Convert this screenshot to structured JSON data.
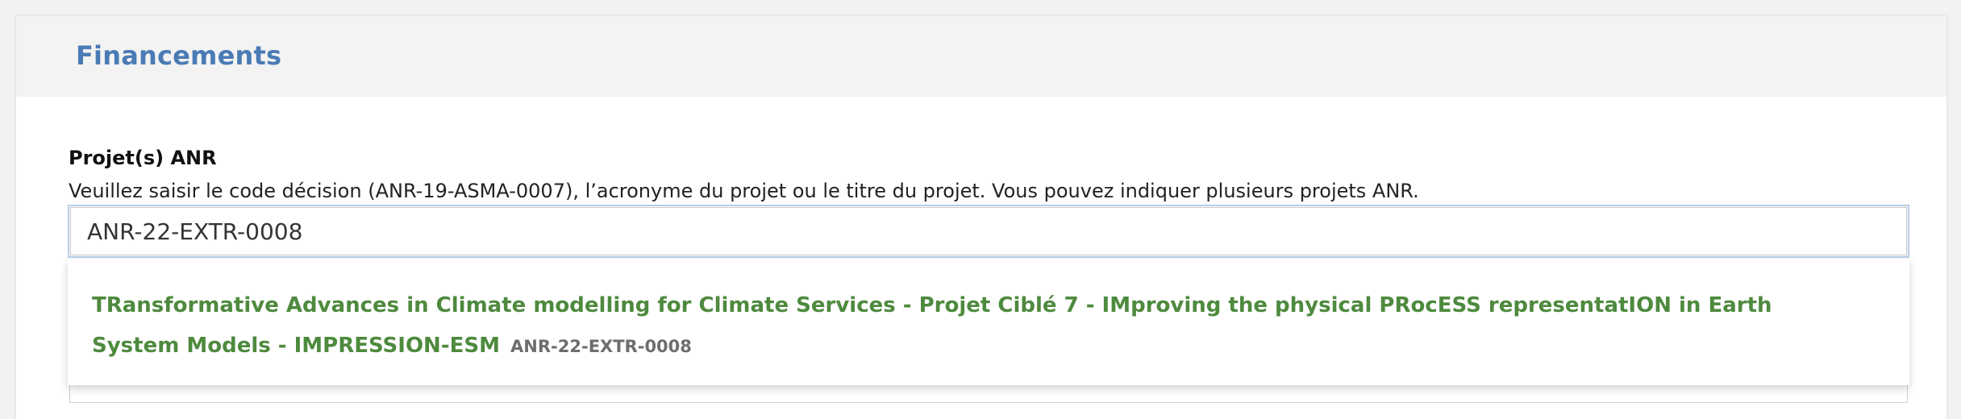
{
  "section": {
    "title": "Financements"
  },
  "field": {
    "label": "Projet(s) ANR",
    "help": "Veuillez saisir le code décision (ANR-19-ASMA-0007), l’acronyme du projet ou le titre du projet. Vous pouvez indiquer plusieurs projets ANR.",
    "value": "ANR-22-EXTR-0008"
  },
  "suggestions": [
    {
      "title": "TRansformative Advances in Climate modelling for Climate Services - Projet Ciblé 7 - IMproving the physical PRocESS representatION in Earth System Models - IMPRESSION-ESM",
      "code": "ANR-22-EXTR-0008"
    }
  ],
  "colors": {
    "title": "#4a7bb5",
    "suggestion": "#4e8a3e",
    "code": "#6d6d6d"
  }
}
